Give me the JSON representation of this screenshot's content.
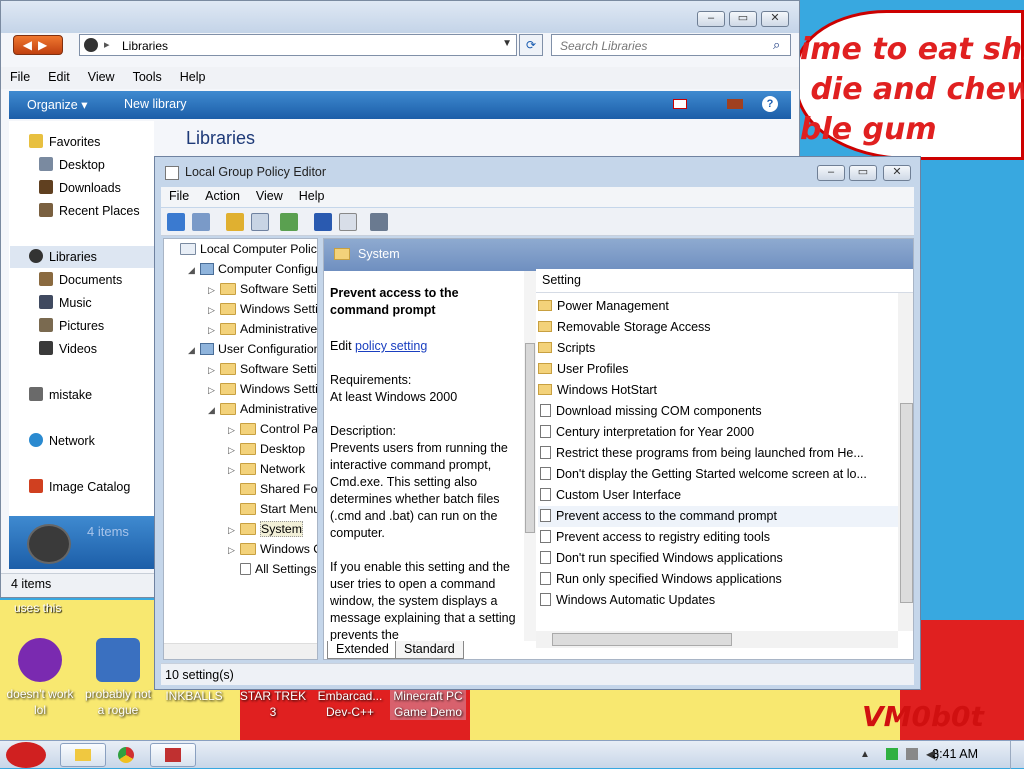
{
  "wallpaper": {
    "text_lines": "ime to eat shit\n die and chew\nble gum",
    "signature": "VM0b0t",
    "uses_label": "uses this"
  },
  "desktop_icons": [
    {
      "label": "doesn't work lol"
    },
    {
      "label": "probably not a rogue"
    },
    {
      "label": "INKBALLS"
    },
    {
      "label": "STAR TREK 3"
    },
    {
      "label": "Embarcad... Dev-C++"
    },
    {
      "label": "Minecraft PC Game Demo"
    }
  ],
  "explorer": {
    "address": "Libraries",
    "search_placeholder": "Search Libraries",
    "menu": [
      "File",
      "Edit",
      "View",
      "Tools",
      "Help"
    ],
    "commands": {
      "organize": "Organize ▾",
      "new_library": "New library"
    },
    "nav": {
      "favorites": "Favorites",
      "desktop": "Desktop",
      "downloads": "Downloads",
      "recent": "Recent Places",
      "libraries": "Libraries",
      "documents": "Documents",
      "music": "Music",
      "pictures": "Pictures",
      "videos": "Videos",
      "mistake": "mistake",
      "network": "Network",
      "image_catalog": "Image Catalog"
    },
    "heading": "Libraries",
    "details_count": "4 items",
    "status": "4 items"
  },
  "gpo": {
    "title": "Local Group Policy Editor",
    "menu": [
      "File",
      "Action",
      "View",
      "Help"
    ],
    "tree": [
      {
        "label": "Local Computer Policy",
        "indent": 0,
        "arrow": "",
        "icon": "policy"
      },
      {
        "label": "Computer Configura",
        "indent": 1,
        "arrow": "◢",
        "icon": "pc"
      },
      {
        "label": "Software Setting",
        "indent": 2,
        "arrow": "▷",
        "icon": "folder"
      },
      {
        "label": "Windows Setting",
        "indent": 2,
        "arrow": "▷",
        "icon": "folder"
      },
      {
        "label": "Administrative Te",
        "indent": 2,
        "arrow": "▷",
        "icon": "folder"
      },
      {
        "label": "User Configuration",
        "indent": 1,
        "arrow": "◢",
        "icon": "pc"
      },
      {
        "label": "Software Setting",
        "indent": 2,
        "arrow": "▷",
        "icon": "folder"
      },
      {
        "label": "Windows Setting",
        "indent": 2,
        "arrow": "▷",
        "icon": "folder"
      },
      {
        "label": "Administrative Te",
        "indent": 2,
        "arrow": "◢",
        "icon": "folder"
      },
      {
        "label": "Control Pane",
        "indent": 3,
        "arrow": "▷",
        "icon": "folder"
      },
      {
        "label": "Desktop",
        "indent": 3,
        "arrow": "▷",
        "icon": "folder"
      },
      {
        "label": "Network",
        "indent": 3,
        "arrow": "▷",
        "icon": "folder"
      },
      {
        "label": "Shared Folde",
        "indent": 3,
        "arrow": "",
        "icon": "folder"
      },
      {
        "label": "Start Menu ar",
        "indent": 3,
        "arrow": "",
        "icon": "folder"
      },
      {
        "label": "System",
        "indent": 3,
        "arrow": "▷",
        "icon": "folder",
        "selected": true
      },
      {
        "label": "Windows Co",
        "indent": 3,
        "arrow": "▷",
        "icon": "folder"
      },
      {
        "label": "All Settings",
        "indent": 3,
        "arrow": "",
        "icon": "settings"
      }
    ],
    "header": "System",
    "extended": {
      "title": "Prevent access to the command prompt",
      "edit_prefix": "Edit",
      "edit_link": "policy setting",
      "req_label": "Requirements:",
      "req_value": "At least Windows 2000",
      "desc_label": "Description:",
      "desc": "Prevents users from running the interactive command prompt, Cmd.exe. This setting also determines whether batch files (.cmd and .bat) can run on the computer.",
      "desc2": "If you enable this setting and the user tries to open a command window, the system displays a message explaining that a setting prevents the"
    },
    "column_header": "Setting",
    "rows": [
      {
        "label": "Power Management",
        "type": "folder"
      },
      {
        "label": "Removable Storage Access",
        "type": "folder"
      },
      {
        "label": "Scripts",
        "type": "folder"
      },
      {
        "label": "User Profiles",
        "type": "folder"
      },
      {
        "label": "Windows HotStart",
        "type": "folder"
      },
      {
        "label": "Download missing COM components",
        "type": "setting"
      },
      {
        "label": "Century interpretation for Year 2000",
        "type": "setting"
      },
      {
        "label": "Restrict these programs from being launched from He...",
        "type": "setting"
      },
      {
        "label": "Don't display the Getting Started welcome screen at lo...",
        "type": "setting"
      },
      {
        "label": "Custom User Interface",
        "type": "setting"
      },
      {
        "label": "Prevent access to the command prompt",
        "type": "setting",
        "selected": true
      },
      {
        "label": "Prevent access to registry editing tools",
        "type": "setting"
      },
      {
        "label": "Don't run specified Windows applications",
        "type": "setting"
      },
      {
        "label": "Run only specified Windows applications",
        "type": "setting"
      },
      {
        "label": "Windows Automatic Updates",
        "type": "setting"
      }
    ],
    "tabs": {
      "extended": "Extended",
      "standard": "Standard"
    },
    "status": "10 setting(s)"
  },
  "taskbar": {
    "clock": "3:41 AM"
  },
  "colors": {
    "wallpaper_blue": "#38a8e0",
    "wallpaper_red": "#e02020",
    "command_bar": "#2a70bc",
    "link": "#1a3fc0"
  }
}
